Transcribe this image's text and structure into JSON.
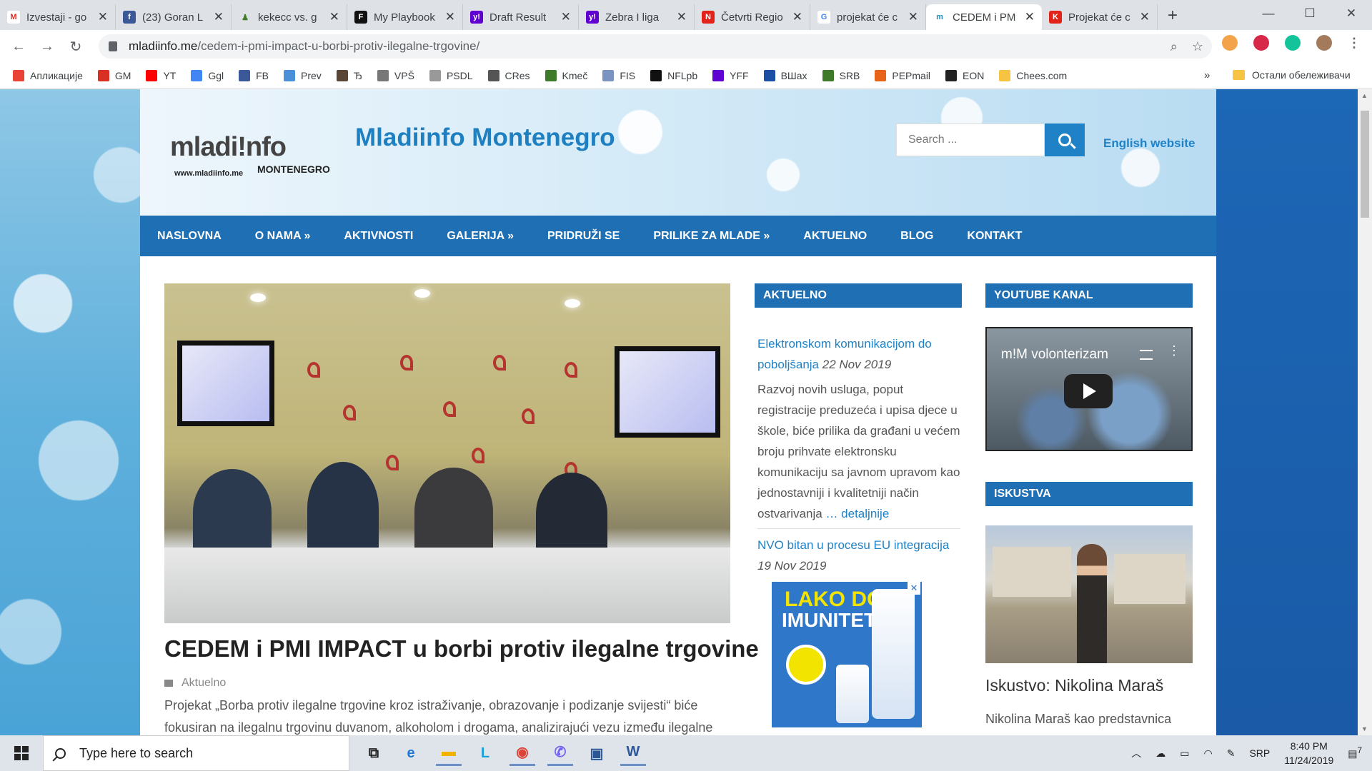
{
  "browser": {
    "tabs": [
      {
        "title": "Izvestaji - go",
        "fav": "M",
        "color": "#ffffff",
        "fg": "#d93025"
      },
      {
        "title": "(23) Goran L",
        "fav": "f",
        "color": "#3b5998",
        "fg": "#ffffff"
      },
      {
        "title": "kekecc vs. g",
        "fav": "♟",
        "color": "#dee1e6",
        "fg": "#3f7a2a"
      },
      {
        "title": "My Playbook",
        "fav": "F",
        "color": "#111111",
        "fg": "#ffffff"
      },
      {
        "title": "Draft Result",
        "fav": "y!",
        "color": "#5f01d1",
        "fg": "#ffffff"
      },
      {
        "title": "Zebra I liga",
        "fav": "y!",
        "color": "#5f01d1",
        "fg": "#ffffff"
      },
      {
        "title": "Četvrti Regio",
        "fav": "N",
        "color": "#e2231a",
        "fg": "#ffffff"
      },
      {
        "title": "projekat će c",
        "fav": "G",
        "color": "#ffffff",
        "fg": "#4285f4"
      },
      {
        "title": "CEDEM i PM",
        "fav": "m",
        "color": "#ffffff",
        "fg": "#1e8bc3"
      },
      {
        "title": "Projekat će c",
        "fav": "K",
        "color": "#e2231a",
        "fg": "#ffffff"
      }
    ],
    "active_tab": 8,
    "new_tab": "+",
    "window_controls": {
      "min": "—",
      "max": "☐",
      "close": "✕"
    },
    "url_domain": "mladiinfo.me",
    "url_path": "/cedem-i-pmi-impact-u-borbi-protiv-ilegalne-trgovine/",
    "bookmarks": [
      {
        "label": "Апликације",
        "color": "#ea4335"
      },
      {
        "label": "GM",
        "color": "#d93025"
      },
      {
        "label": "YT",
        "color": "#ff0000"
      },
      {
        "label": "Ggl",
        "color": "#4285f4"
      },
      {
        "label": "FB",
        "color": "#3b5998"
      },
      {
        "label": "Prev",
        "color": "#4a90d9"
      },
      {
        "label": "Ђ",
        "color": "#5b4636"
      },
      {
        "label": "VPŠ",
        "color": "#777777"
      },
      {
        "label": "PSDL",
        "color": "#999999"
      },
      {
        "label": "CRes",
        "color": "#555555"
      },
      {
        "label": "Kmeč",
        "color": "#3f7a2a"
      },
      {
        "label": "FIS",
        "color": "#7a93c0"
      },
      {
        "label": "NFLpb",
        "color": "#111111"
      },
      {
        "label": "YFF",
        "color": "#5f01d1"
      },
      {
        "label": "ВШах",
        "color": "#1a4fa3"
      },
      {
        "label": "SRB",
        "color": "#3f7a2a"
      },
      {
        "label": "PEPmail",
        "color": "#e8641b"
      },
      {
        "label": "EON",
        "color": "#222222"
      },
      {
        "label": "Chees.com",
        "color": "#f6c343"
      }
    ],
    "bookmarks_more": "»",
    "bookmarks_other": "Остали обележивачи"
  },
  "site": {
    "logo_text": "mladi!nfo",
    "logo_country": "MONTENEGRO",
    "logo_url": "www.mladiinfo.me",
    "title": "Mladiinfo Montenegro",
    "search_placeholder": "Search ...",
    "english_link": "English website",
    "menu": [
      "NASLOVNA",
      "O NAMA »",
      "AKTIVNOSTI",
      "GALERIJA »",
      "PRIDRUŽI SE",
      "PRILIKE ZA MLADE »",
      "AKTUELNO",
      "BLOG",
      "KONTAKT"
    ],
    "article": {
      "title": "CEDEM i PMI IMPACT u borbi protiv ilegalne trgovine",
      "category": "Aktuelno",
      "text_line1": "Projekat „Borba protiv ilegalne trgovine kroz istraživanje, obrazovanje i podizanje svijesti“ biće",
      "text_line2": "fokusiran na ilegalnu trgovinu duvanom, alkoholom i drogama, analizirajući vezu između ilegalne"
    },
    "aktuelno": {
      "title": "AKTUELNO",
      "item1_link": "Elektronskom komunikacijom do poboljšanja",
      "item1_date": "22 Nov 2019",
      "item1_text": "Razvoj novih usluga, poput registracije preduzeća i upisa djece u škole, biće prilika da građani u većem broju prihvate elektronsku komunikaciju sa javnom upravom kao jednostavniji i kvalitetniji način ostvarivanja",
      "item1_more": "… detaljnije",
      "item2_link": "NVO bitan u procesu EU integracija",
      "item2_date": "19 Nov 2019"
    },
    "ad": {
      "line1": "LAKO DO",
      "line2": "IMUNITETA",
      "close": "✕"
    },
    "youtube": {
      "title": "YOUTUBE KANAL",
      "video_title": "m!M volonterizam"
    },
    "iskustva": {
      "title": "ISKUSTVA",
      "post_title": "Iskustvo: Nikolina Maraš",
      "post_text": "Nikolina Maraš kao predstavnica"
    }
  },
  "taskbar": {
    "search_placeholder": "Type here to search",
    "apps": [
      {
        "name": "task-view-icon",
        "glyph": "⧉",
        "color": "#222222",
        "open": false
      },
      {
        "name": "edge-icon",
        "glyph": "e",
        "color": "#1e78d4",
        "open": false
      },
      {
        "name": "file-explorer-icon",
        "glyph": "▬",
        "color": "#f0b400",
        "open": true
      },
      {
        "name": "app-l-icon",
        "glyph": "L",
        "color": "#1aa0d8",
        "open": false
      },
      {
        "name": "chrome-icon",
        "glyph": "◉",
        "color": "#db4437",
        "open": true
      },
      {
        "name": "viber-icon",
        "glyph": "✆",
        "color": "#7360f2",
        "open": true
      },
      {
        "name": "save-app-icon",
        "glyph": "▣",
        "color": "#2b5797",
        "open": false
      },
      {
        "name": "word-icon",
        "glyph": "W",
        "color": "#2b579a",
        "open": true
      }
    ],
    "language": "SRP",
    "time": "8:40 PM",
    "date": "11/24/2019",
    "notifications": "7"
  }
}
